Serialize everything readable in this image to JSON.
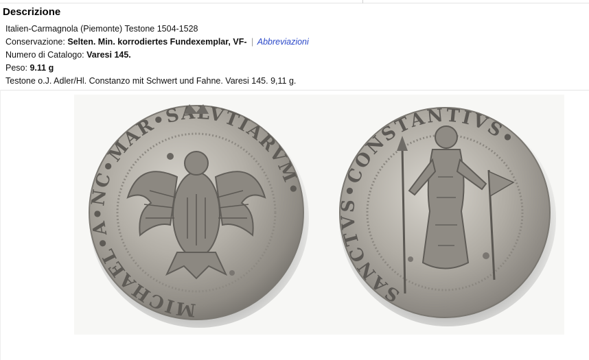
{
  "section": {
    "title": "Descrizione"
  },
  "details": {
    "line1": "Italien-Carmagnola (Piemonte) Testone 1504-1528",
    "conservation_label": "Conservazione:",
    "conservation_value": "Selten. Min. korrodiertes Fundexemplar, VF-",
    "separator": "|",
    "abbrev_link": "Abbreviazioni",
    "catalog_label": "Numero di Catalogo:",
    "catalog_value": "Varesi 145.",
    "weight_label": "Peso:",
    "weight_value": "9.11 g",
    "description": "Testone o.J. Adler/Hl. Constanzo mit Schwert und Fahne. Varesi 145. 9,11 g."
  },
  "image": {
    "obverse_legend": "MICHAEL•A•NC•MAR•SALVTIARVM•",
    "reverse_legend": "SANCTVS•CONSTANTIVS•",
    "icon": "coin-photo"
  },
  "colors": {
    "link": "#2a48c9",
    "coin_silver": "#a9a59d",
    "background": "#f7f7f5"
  }
}
